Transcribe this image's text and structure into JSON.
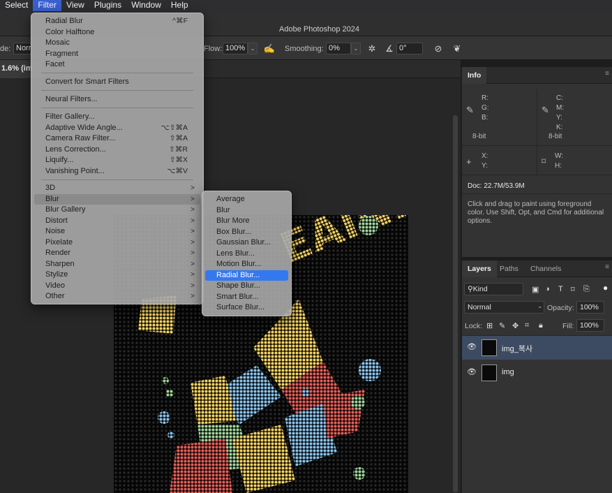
{
  "menubar": [
    "Select",
    "Filter",
    "View",
    "Plugins",
    "Window",
    "Help"
  ],
  "window_title": "Adobe Photoshop 2024",
  "options": {
    "mode_label": "de:",
    "mode_value": "Norr",
    "flow_label": "Flow:",
    "flow_value": "100%",
    "smoothing_label": "Smoothing:",
    "smoothing_value": "0%",
    "angle_value": "0°"
  },
  "doc_tab": "1.6% (im",
  "filter_menu": {
    "g1": [
      {
        "label": "Radial Blur",
        "shortcut": "^⌘F"
      },
      {
        "label": "Color Halftone"
      },
      {
        "label": "Mosaic"
      },
      {
        "label": "Fragment"
      },
      {
        "label": "Facet"
      }
    ],
    "g2": [
      {
        "label": "Convert for Smart Filters"
      }
    ],
    "g3": [
      {
        "label": "Neural Filters..."
      }
    ],
    "g4": [
      {
        "label": "Filter Gallery..."
      },
      {
        "label": "Adaptive Wide Angle...",
        "shortcut": "⌥⇧⌘A"
      },
      {
        "label": "Camera Raw Filter...",
        "shortcut": "⇧⌘A"
      },
      {
        "label": "Lens Correction...",
        "shortcut": "⇧⌘R"
      },
      {
        "label": "Liquify...",
        "shortcut": "⇧⌘X"
      },
      {
        "label": "Vanishing Point...",
        "shortcut": "⌥⌘V"
      }
    ],
    "g5": [
      "3D",
      "Blur",
      "Blur Gallery",
      "Distort",
      "Noise",
      "Pixelate",
      "Render",
      "Sharpen",
      "Stylize",
      "Video",
      "Other"
    ]
  },
  "blur_menu": [
    "Average",
    "Blur",
    "Blur More",
    "Box Blur...",
    "Gaussian Blur...",
    "Lens Blur...",
    "Motion Blur...",
    "Radial Blur...",
    "Shape Blur...",
    "Smart Blur...",
    "Surface Blur..."
  ],
  "info_panel": {
    "tab": "Info",
    "rgb": [
      "R:",
      "G:",
      "B:"
    ],
    "cmyk": [
      "C:",
      "M:",
      "Y:",
      "K:"
    ],
    "bit_left": "8-bit",
    "bit_right": "8-bit",
    "xy": [
      "X:",
      "Y:"
    ],
    "wh": [
      "W:",
      "H:"
    ],
    "doc": "Doc: 22.7M/53.9M",
    "hint": "Click and drag to paint using foreground color.  Use Shift, Opt, and Cmd for additional options."
  },
  "layers_panel": {
    "tabs": [
      "Layers",
      "Paths",
      "Channels"
    ],
    "kind": "Kind",
    "blend": "Normal",
    "opacity_label": "Opacity:",
    "opacity_value": "100%",
    "lock_label": "Lock:",
    "fill_label": "Fill:",
    "fill_value": "100%",
    "layers": [
      "img_복사",
      "img"
    ]
  },
  "artwork_text": "EAINK",
  "colors": {
    "accent": "#3478f0",
    "selected_layer": "#3d4b62"
  }
}
